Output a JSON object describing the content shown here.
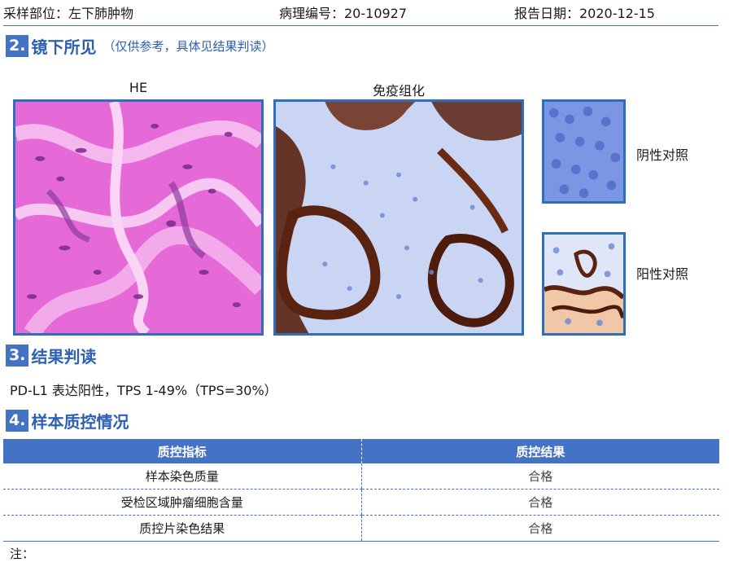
{
  "header": {
    "site": "采样部位：左下肺肿物",
    "pathology_no": "病理编号：20-10927",
    "report_date": "报告日期：2020-12-15"
  },
  "section2": {
    "number": "2.",
    "title": "镜下所见",
    "note": "（仅供参考，具体见结果判读）",
    "he_caption": "HE",
    "ihc_caption": "免疫组化",
    "negative_label": "阴性对照",
    "positive_label": "阳性对照"
  },
  "section3": {
    "number": "3.",
    "title": "结果判读",
    "result": "PD-L1 表达阳性，TPS 1-49%（TPS=30%）"
  },
  "section4": {
    "number": "4.",
    "title": "样本质控情况",
    "columns": [
      "质控指标",
      "质控结果"
    ],
    "rows": [
      [
        "样本染色质量",
        "合格"
      ],
      [
        "受检区域肿瘤细胞含量",
        "合格"
      ],
      [
        "质控片染色结果",
        "合格"
      ]
    ]
  },
  "footer": {
    "note": "注："
  },
  "colors": {
    "accent": "#4472c4",
    "title_blue": "#2e5fb3",
    "he_pink": "#e56ad8",
    "he_purple": "#7a2a8e",
    "ihc_brown": "#5a2210",
    "hematoxylin_blue": "#6b86d6"
  }
}
